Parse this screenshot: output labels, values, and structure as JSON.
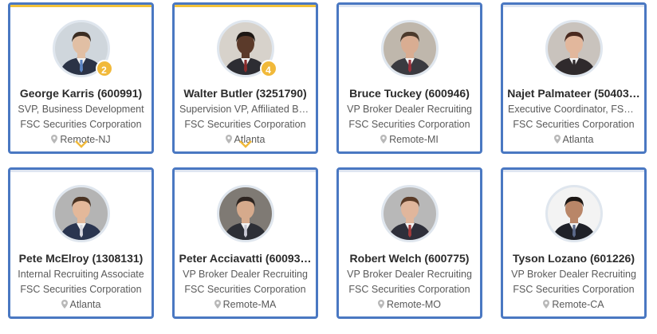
{
  "cards": [
    {
      "name": "George Karris (600991)",
      "title": "SVP, Business Development",
      "company": "FSC Securities Corporation",
      "location": "Remote-NJ",
      "badge": "2",
      "selected": true,
      "expand": true,
      "skin": "#e1bfa4",
      "hair": "#3b2d23",
      "suit": "#2b3346",
      "tie": "#5b84c2",
      "bg": "#cfd6dc"
    },
    {
      "name": "Walter Butler (3251790)",
      "title": "Supervision VP, Affiliated Br…",
      "company": "FSC Securities Corporation",
      "location": "Atlanta",
      "badge": "4",
      "selected": true,
      "expand": true,
      "skin": "#5b3a2a",
      "hair": "#1d1714",
      "suit": "#2d2d33",
      "tie": "#8a2b2b",
      "bg": "#d7d2cb"
    },
    {
      "name": "Bruce Tuckey (600946)",
      "title": "VP Broker Dealer Recruiting",
      "company": "FSC Securities Corporation",
      "location": "Remote-MI",
      "badge": "",
      "selected": false,
      "expand": false,
      "skin": "#d9ad92",
      "hair": "#4b3a2c",
      "suit": "#3a3a40",
      "tie": "#9a2f3a",
      "bg": "#bfb7ac"
    },
    {
      "name": "Najet Palmateer (50403…",
      "title": "Executive Coordinator, FSC…",
      "company": "FSC Securities Corporation",
      "location": "Atlanta",
      "badge": "",
      "selected": false,
      "expand": false,
      "skin": "#e2b79c",
      "hair": "#4a2a1f",
      "suit": "#2f2a2c",
      "tie": "#2f2a2c",
      "bg": "#c9c3bd"
    },
    {
      "name": "Pete McElroy (1308131)",
      "title": "Internal Recruiting Associate",
      "company": "FSC Securities Corporation",
      "location": "Atlanta",
      "badge": "",
      "selected": false,
      "expand": false,
      "skin": "#e3b89a",
      "hair": "#4a3322",
      "suit": "#2a3550",
      "tie": "#d8d8e0",
      "bg": "#b4b4b4"
    },
    {
      "name": "Peter Acciavatti (60093…",
      "title": "VP Broker Dealer Recruiting",
      "company": "FSC Securities Corporation",
      "location": "Remote-MA",
      "badge": "",
      "selected": false,
      "expand": false,
      "skin": "#d6aa8c",
      "hair": "#2d2420",
      "suit": "#2d2f36",
      "tie": "#c9c9d4",
      "bg": "#7f7a74"
    },
    {
      "name": "Robert Welch (600775)",
      "title": "VP Broker Dealer Recruiting",
      "company": "FSC Securities Corporation",
      "location": "Remote-MO",
      "badge": "",
      "selected": false,
      "expand": false,
      "skin": "#e0b69c",
      "hair": "#5a3b27",
      "suit": "#2e2f3a",
      "tie": "#a43b3b",
      "bg": "#b8b8b8"
    },
    {
      "name": "Tyson Lozano (601226)",
      "title": "VP Broker Dealer Recruiting",
      "company": "FSC Securities Corporation",
      "location": "Remote-CA",
      "badge": "",
      "selected": false,
      "expand": false,
      "skin": "#b98668",
      "hair": "#1c1714",
      "suit": "#1f2128",
      "tie": "#5c6a8a",
      "bg": "#f3f3f3"
    }
  ]
}
